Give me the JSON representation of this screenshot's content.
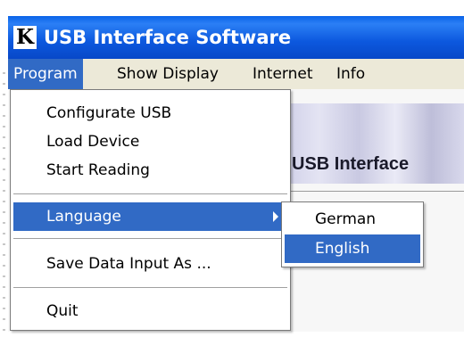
{
  "window": {
    "title": "USB Interface Software",
    "icon_glyph": "K",
    "icon": "app-logo-icon"
  },
  "menubar": {
    "items": [
      {
        "label": "Program",
        "active": true
      },
      {
        "label": "Show Display",
        "active": false
      },
      {
        "label": "Internet",
        "active": false
      },
      {
        "label": "Info",
        "active": false
      }
    ]
  },
  "program_menu": {
    "items": [
      {
        "label": "Configurate USB"
      },
      {
        "label": "Load Device"
      },
      {
        "label": "Start Reading"
      },
      {
        "label": "Language",
        "has_submenu": true,
        "selected": true
      },
      {
        "label": "Save Data Input As ..."
      },
      {
        "label": "Quit"
      }
    ]
  },
  "language_submenu": {
    "items": [
      {
        "label": "German",
        "selected": false
      },
      {
        "label": "English",
        "selected": true
      }
    ]
  },
  "banner": {
    "text": "USB Interface"
  },
  "colors": {
    "titlebar": "#0a63e8",
    "highlight": "#316ac5",
    "menu_bg": "#ece9d8"
  }
}
